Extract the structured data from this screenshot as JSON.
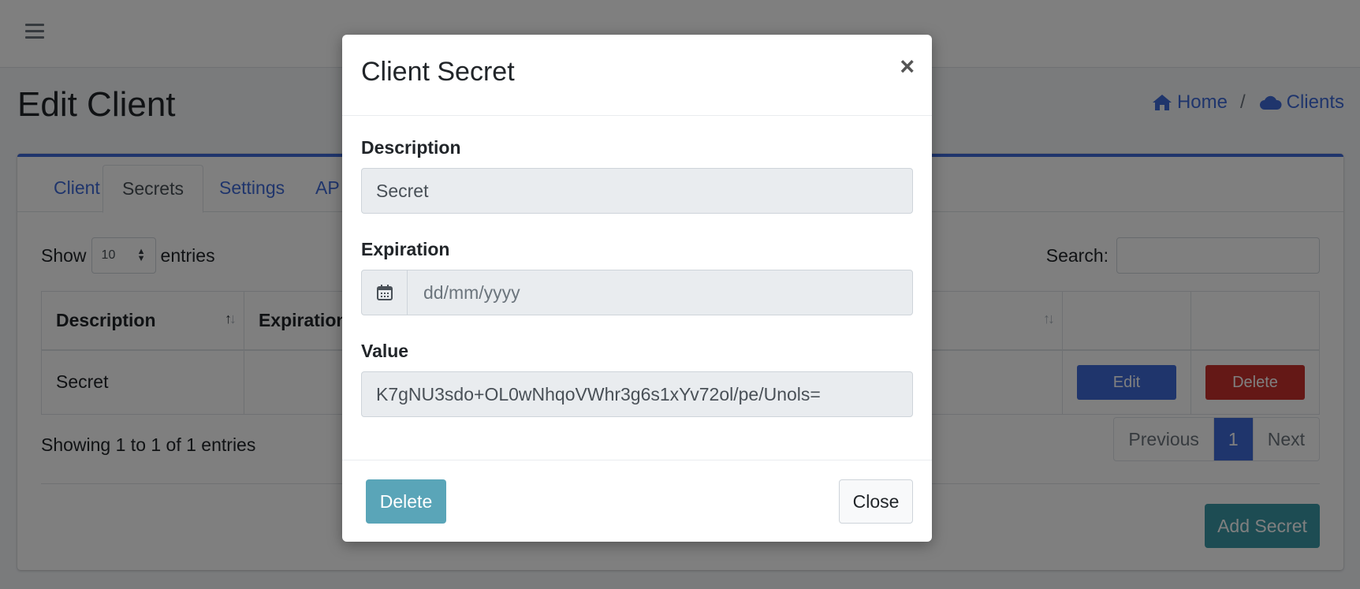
{
  "header": {
    "page_title": "Edit Client",
    "breadcrumb": {
      "home": "Home",
      "separator": "/",
      "clients": "Clients"
    }
  },
  "tabs": [
    {
      "label": "Client"
    },
    {
      "label": "Secrets"
    },
    {
      "label": "Settings"
    },
    {
      "label": "AP"
    }
  ],
  "table_controls": {
    "show_label": "Show",
    "page_length": "10",
    "entries_label": "entries",
    "search_label": "Search:"
  },
  "table": {
    "columns": [
      "Description",
      "Expiration"
    ],
    "rows": [
      {
        "description": "Secret",
        "expiration": "",
        "edit_label": "Edit",
        "delete_label": "Delete"
      }
    ]
  },
  "pagination": {
    "info": "Showing 1 to 1 of 1 entries",
    "previous": "Previous",
    "current_page": "1",
    "next": "Next"
  },
  "add_secret_label": "Add Secret",
  "modal": {
    "title": "Client Secret",
    "close_symbol": "×",
    "description_label": "Description",
    "description_value": "Secret",
    "expiration_label": "Expiration",
    "expiration_placeholder": "dd/mm/yyyy",
    "value_label": "Value",
    "value_value": "K7gNU3sdo+OL0wNhqoVWhr3g6s1xYv72ol/pe/Unols=",
    "delete_label": "Delete",
    "close_label": "Close"
  },
  "colors": {
    "accent": "#3f6ad8",
    "danger": "#c9302c",
    "info": "#5aa5b8",
    "backdrop": "rgba(0,0,0,0.5)"
  }
}
